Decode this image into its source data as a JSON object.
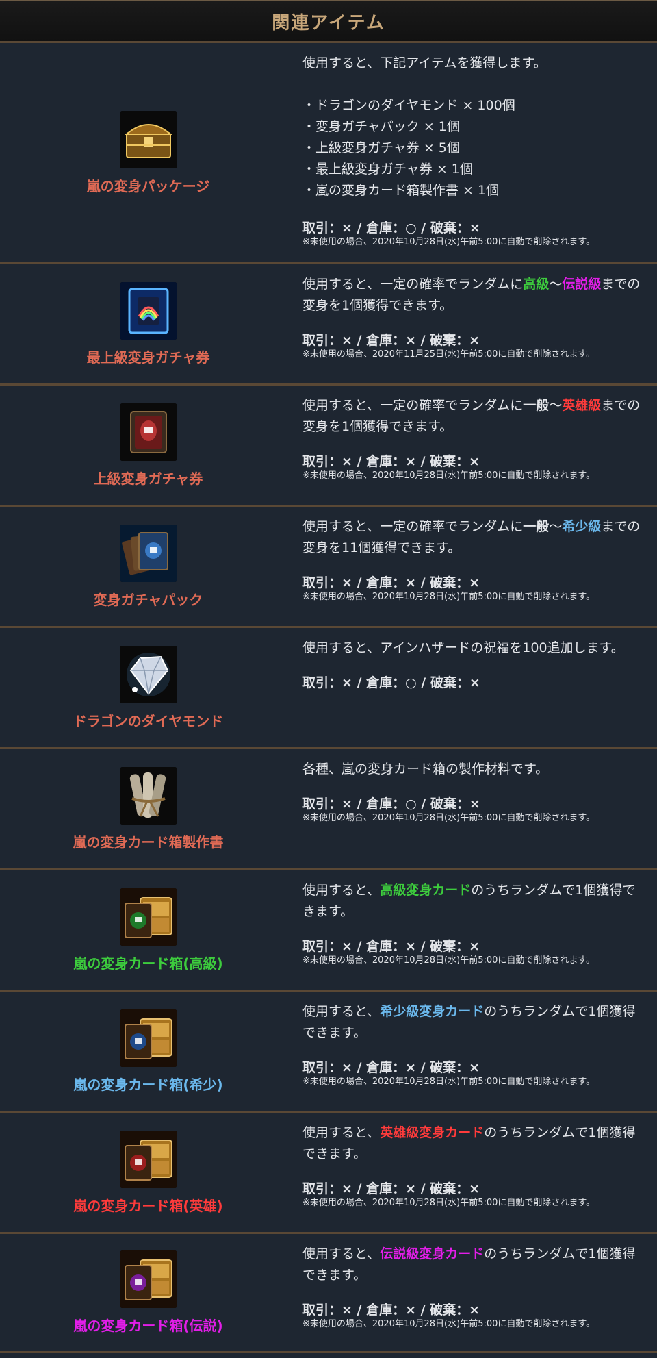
{
  "page": {
    "title": "関連アイテム"
  },
  "colors": {
    "default_name": "#e06a55",
    "high": "#3dcc3d",
    "rare": "#6bb8ec",
    "hero": "#ff3b3b",
    "legend": "#e21ee8",
    "text": "#e4e6ea",
    "header_gold": "#c8a77a",
    "divider": "#5a4835"
  },
  "items": [
    {
      "name": "嵐の変身パッケージ",
      "icon": "treasure-chest-icon",
      "desc": [
        {
          "t": "使用すると、下記アイテムを獲得します。\n\n・ドラゴンのダイヤモンド × 100個\n・変身ガチャパック × 1個\n・上級変身ガチャ券 × 5個\n・最上級変身ガチャ券 × 1個\n・嵐の変身カード箱製作書 × 1個"
        }
      ],
      "trade": "取引：× / 倉庫：○ / 破棄：×",
      "note": "※未使用の場合、2020年10月28日(水)午前5:00に自動で削除されます。"
    },
    {
      "name": "最上級変身ガチャ券",
      "icon": "rainbow-card-ticket-icon",
      "desc": [
        {
          "t": "使用すると、一定の確率でランダムに"
        },
        {
          "t": "高級",
          "c": "high"
        },
        {
          "t": "～"
        },
        {
          "t": "伝説級",
          "c": "legend"
        },
        {
          "t": "までの変身を1個獲得できます。"
        }
      ],
      "trade": "取引：× / 倉庫：× / 破棄：×",
      "note": "※未使用の場合、2020年11月25日(水)午前5:00に自動で削除されます。"
    },
    {
      "name": "上級変身ガチャ券",
      "icon": "red-card-ticket-icon",
      "desc": [
        {
          "t": "使用すると、一定の確率でランダムに"
        },
        {
          "t": "一般",
          "c": "bold"
        },
        {
          "t": "～"
        },
        {
          "t": "英雄級",
          "c": "hero"
        },
        {
          "t": "までの変身を1個獲得できます。"
        }
      ],
      "trade": "取引：× / 倉庫：× / 破棄：×",
      "note": "※未使用の場合、2020年10月28日(水)午前5:00に自動で削除されます。"
    },
    {
      "name": "変身ガチャパック",
      "icon": "card-pack-icon",
      "desc": [
        {
          "t": "使用すると、一定の確率でランダムに"
        },
        {
          "t": "一般",
          "c": "bold"
        },
        {
          "t": "～"
        },
        {
          "t": "希少級",
          "c": "rare"
        },
        {
          "t": "までの変身を11個獲得できます。"
        }
      ],
      "trade": "取引：× / 倉庫：× / 破棄：×",
      "note": "※未使用の場合、2020年10月28日(水)午前5:00に自動で削除されます。"
    },
    {
      "name": "ドラゴンのダイヤモンド",
      "icon": "diamond-icon",
      "desc": [
        {
          "t": "使用すると、アインハザードの祝福を100追加します。"
        }
      ],
      "trade": "取引：× / 倉庫：○ / 破棄：×",
      "note": ""
    },
    {
      "name": "嵐の変身カード箱製作書",
      "icon": "scroll-bundle-icon",
      "desc": [
        {
          "t": "各種、嵐の変身カード箱の製作材料です。"
        }
      ],
      "trade": "取引：× / 倉庫：○ / 破棄：×",
      "note": "※未使用の場合、2020年10月28日(水)午前5:00に自動で削除されます。"
    },
    {
      "name": "嵐の変身カード箱(高級)",
      "nameColor": "high",
      "icon": "green-card-box-icon",
      "desc": [
        {
          "t": "使用すると、"
        },
        {
          "t": "高級変身カード",
          "c": "high"
        },
        {
          "t": "のうちランダムで1個獲得できます。"
        }
      ],
      "trade": "取引：× / 倉庫：× / 破棄：×",
      "note": "※未使用の場合、2020年10月28日(水)午前5:00に自動で削除されます。"
    },
    {
      "name": "嵐の変身カード箱(希少)",
      "nameColor": "rare",
      "icon": "blue-card-box-icon",
      "desc": [
        {
          "t": "使用すると、"
        },
        {
          "t": "希少級変身カード",
          "c": "rare"
        },
        {
          "t": "のうちランダムで1個獲得できます。"
        }
      ],
      "trade": "取引：× / 倉庫：× / 破棄：×",
      "note": "※未使用の場合、2020年10月28日(水)午前5:00に自動で削除されます。"
    },
    {
      "name": "嵐の変身カード箱(英雄)",
      "nameColor": "hero",
      "icon": "red-card-box-icon",
      "desc": [
        {
          "t": "使用すると、"
        },
        {
          "t": "英雄級変身カード",
          "c": "hero"
        },
        {
          "t": "のうちランダムで1個獲得できます。"
        }
      ],
      "trade": "取引：× / 倉庫：× / 破棄：×",
      "note": "※未使用の場合、2020年10月28日(水)午前5:00に自動で削除されます。"
    },
    {
      "name": "嵐の変身カード箱(伝説)",
      "nameColor": "legend",
      "icon": "purple-card-box-icon",
      "desc": [
        {
          "t": "使用すると、"
        },
        {
          "t": "伝説級変身カード",
          "c": "legend"
        },
        {
          "t": "のうちランダムで1個獲得できます。"
        }
      ],
      "trade": "取引：× / 倉庫：× / 破棄：×",
      "note": "※未使用の場合、2020年10月28日(水)午前5:00に自動で削除されます。"
    }
  ]
}
